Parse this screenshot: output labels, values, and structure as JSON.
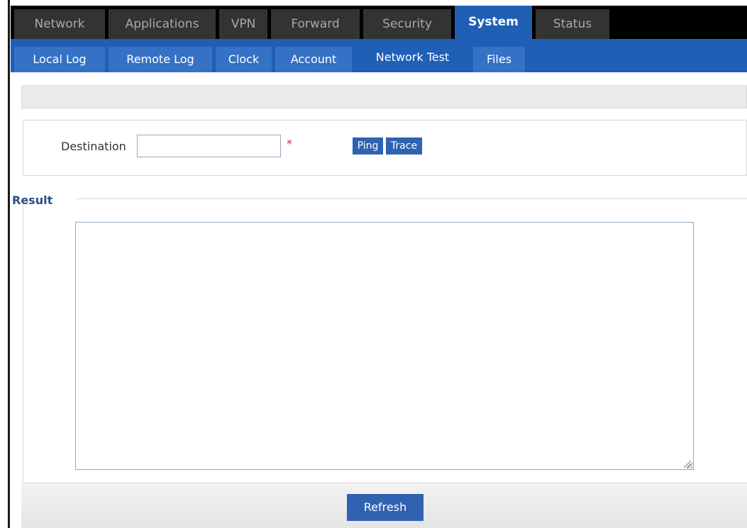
{
  "topnav": {
    "tabs": [
      {
        "label": "Network"
      },
      {
        "label": "Applications"
      },
      {
        "label": "VPN"
      },
      {
        "label": "Forward"
      },
      {
        "label": "Security"
      },
      {
        "label": "System",
        "active": true
      },
      {
        "label": "Status"
      }
    ]
  },
  "subnav": {
    "tabs": [
      {
        "label": "Local Log"
      },
      {
        "label": "Remote Log"
      },
      {
        "label": "Clock"
      },
      {
        "label": "Account"
      },
      {
        "label": "Network Test",
        "active": true
      },
      {
        "label": "Files"
      }
    ]
  },
  "form": {
    "destination_label": "Destination",
    "destination_value": "",
    "required_mark": "*",
    "ping_label": "Ping",
    "trace_label": "Trace"
  },
  "result": {
    "legend": "Result",
    "content": ""
  },
  "footer": {
    "refresh_label": "Refresh"
  },
  "colors": {
    "nav_background": "#000000",
    "tab_inactive": "#333333",
    "accent_blue": "#1f5fb6",
    "button_blue": "#2f62b0",
    "required_red": "#d0262b"
  },
  "icons": {
    "resize_grip": "resize-grip-icon"
  }
}
